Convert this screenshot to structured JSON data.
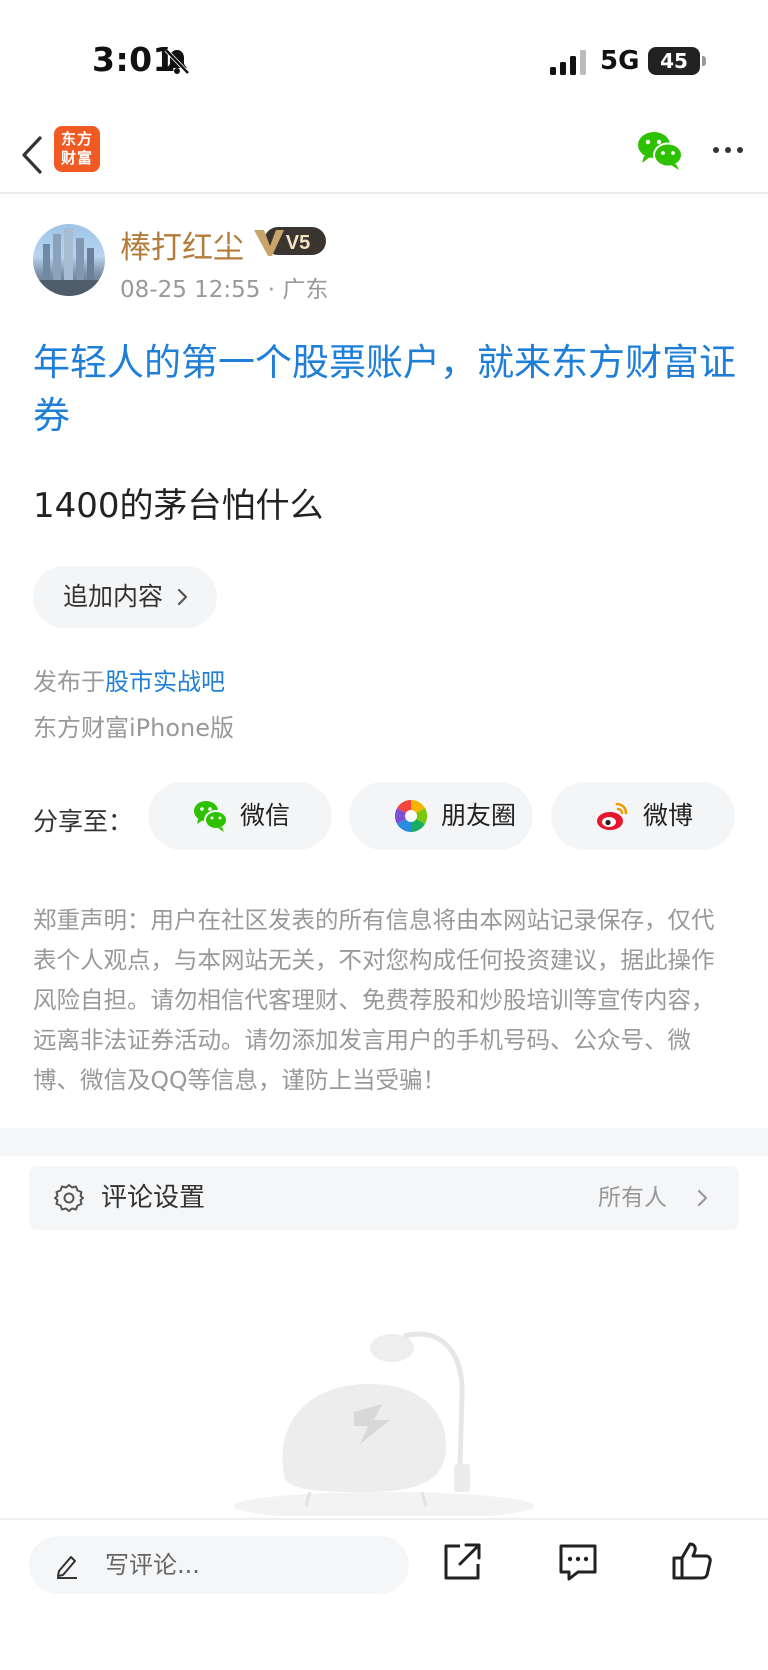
{
  "status_bar": {
    "time": "3:01",
    "network": "5G",
    "battery": "45"
  },
  "nav": {
    "brand_logo_text_line1": "东方",
    "brand_logo_text_line2": "财富"
  },
  "author": {
    "name": "棒打红尘",
    "level": "V5",
    "timestamp": "08-25 12:55",
    "location": "广东"
  },
  "post": {
    "title": "年轻人的第一个股票账户，就来东方财富证券",
    "body": "1400的茅台怕什么",
    "append_label": "追加内容",
    "published_prefix": "发布于",
    "forum": "股市实战吧",
    "client": "东方财富iPhone版"
  },
  "share": {
    "label": "分享至：",
    "items": [
      {
        "label": "微信",
        "icon": "wechat-icon"
      },
      {
        "label": "朋友圈",
        "icon": "moments-icon"
      },
      {
        "label": "微博",
        "icon": "weibo-icon"
      }
    ]
  },
  "disclaimer": "郑重声明：用户在社区发表的所有信息将由本网站记录保存，仅代表个人观点，与本网站无关，不对您构成任何投资建议，据此操作风险自担。请勿相信代客理财、免费荐股和炒股培训等宣传内容，远离非法证券活动。请勿添加发言用户的手机号码、公众号、微博、微信及QQ等信息，谨防上当受骗！",
  "comment_settings": {
    "label": "评论设置",
    "value": "所有人"
  },
  "bottom_bar": {
    "comment_placeholder": "写评论..."
  },
  "colors": {
    "accent_blue": "#1f7fd8",
    "author_gold": "#b47c3a",
    "brand_orange": "#f15a22",
    "wechat_green": "#2dc100"
  }
}
